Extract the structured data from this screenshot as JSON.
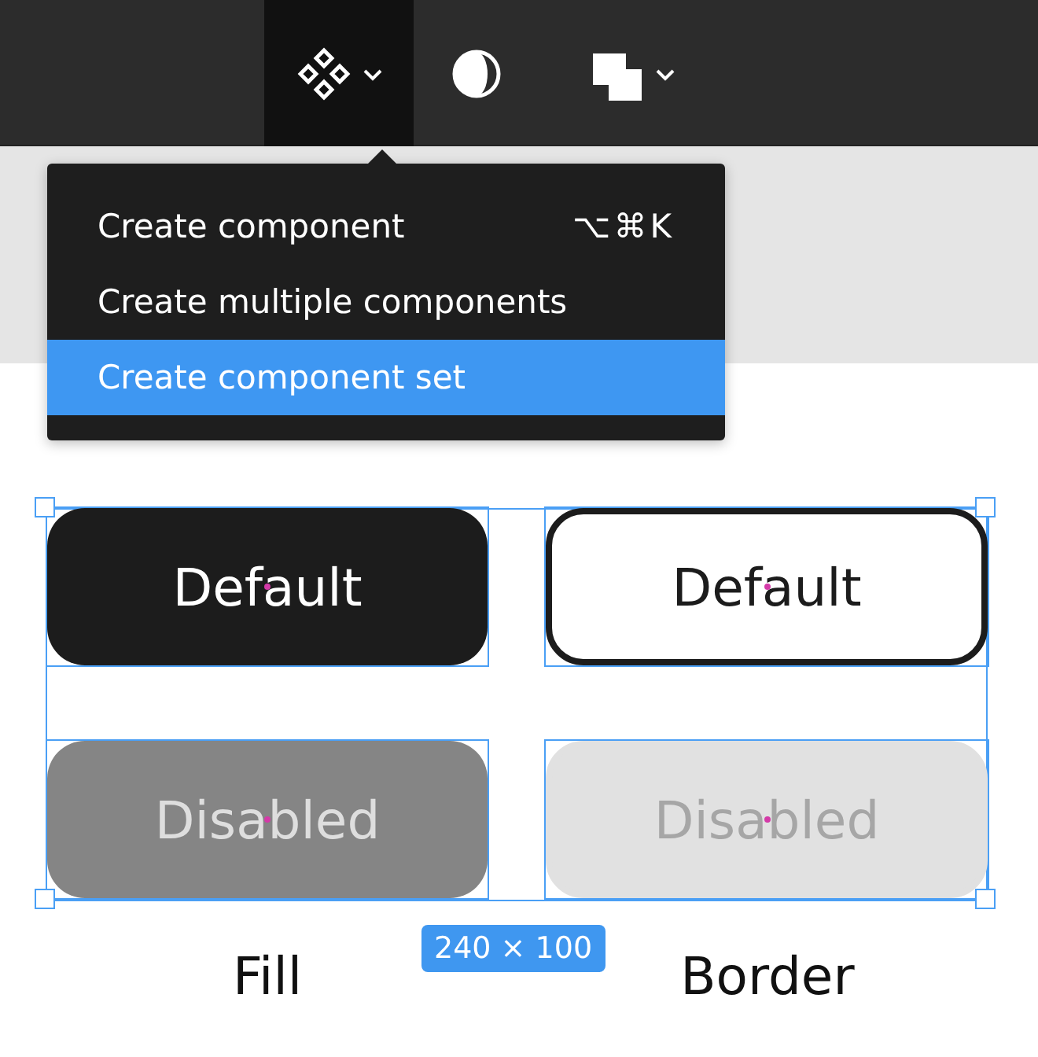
{
  "toolbar": {
    "tools": [
      {
        "kind": "components",
        "selected": true,
        "dropdown": true
      },
      {
        "kind": "contrast",
        "selected": false,
        "dropdown": false
      },
      {
        "kind": "boolean",
        "selected": false,
        "dropdown": true
      }
    ]
  },
  "menu": {
    "items": [
      {
        "label": "Create component",
        "shortcut": "⌥⌘K",
        "selected": false
      },
      {
        "label": "Create multiple components",
        "selected": false
      },
      {
        "label": "Create component set",
        "selected": true
      }
    ]
  },
  "canvas": {
    "variants": [
      {
        "kind": "fill",
        "label": "Default",
        "disabled": false
      },
      {
        "kind": "border",
        "label": "Default",
        "disabled": false
      },
      {
        "kind": "fill",
        "label": "Disabled",
        "disabled": true
      },
      {
        "kind": "border",
        "label": "Disabled",
        "disabled": true
      }
    ],
    "size_badge": "240 × 100",
    "column_labels": [
      "Fill",
      "Border"
    ]
  }
}
